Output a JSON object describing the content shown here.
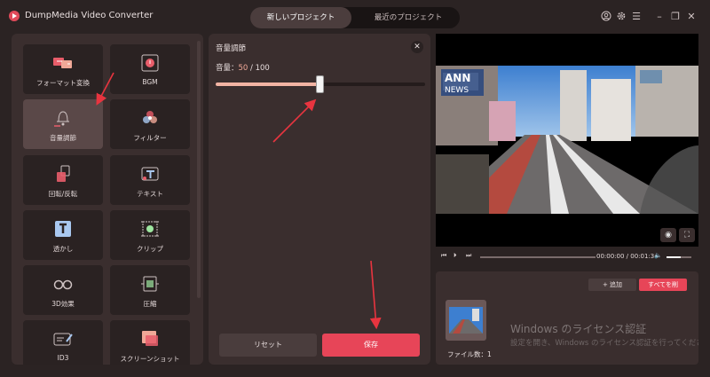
{
  "app": {
    "title": "DumpMedia Video Converter"
  },
  "tabs": {
    "new": "新しいプロジェクト",
    "recent": "最近のプロジェクト"
  },
  "tools": [
    {
      "label": "フォーマット変換",
      "icon": "format-convert-icon"
    },
    {
      "label": "BGM",
      "icon": "bgm-icon"
    },
    {
      "label": "音量調節",
      "icon": "volume-adjust-icon"
    },
    {
      "label": "フィルター",
      "icon": "filter-icon"
    },
    {
      "label": "回転/反転",
      "icon": "rotate-icon"
    },
    {
      "label": "テキスト",
      "icon": "text-icon"
    },
    {
      "label": "透かし",
      "icon": "watermark-icon"
    },
    {
      "label": "クリップ",
      "icon": "clip-icon"
    },
    {
      "label": "3D効果",
      "icon": "3d-glasses-icon"
    },
    {
      "label": "圧縮",
      "icon": "compress-icon"
    },
    {
      "label": "ID3",
      "icon": "id3-icon"
    },
    {
      "label": "スクリーンショット",
      "icon": "screenshot-icon"
    }
  ],
  "volume_panel": {
    "title": "音量調節",
    "label": "音量：",
    "value": "50",
    "max": "/ 100",
    "level": 0.5,
    "reset": "リセット",
    "save": "保存"
  },
  "player": {
    "time": "00:00:00 / 00:01:34",
    "progress": 0.0
  },
  "files": {
    "add": "+ 追加",
    "clear": "すべてを削",
    "count": "ファイル数：1"
  },
  "watermark": {
    "title": "Windows のライセンス認証",
    "subtitle": "設定を開き、Windows のライセンス認証を行ってください。"
  },
  "colors": {
    "accent": "#e74558",
    "slider": "#f2b4a4",
    "panel": "#3a2e2e",
    "bg": "#2b2323"
  }
}
